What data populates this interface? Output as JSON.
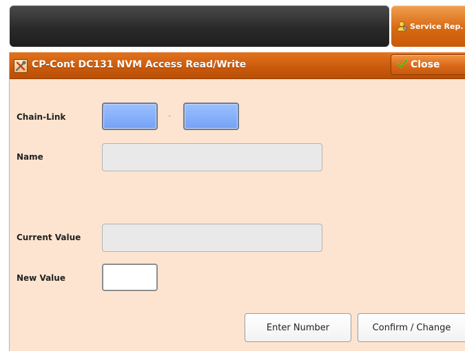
{
  "header": {
    "service_label": "Service Rep."
  },
  "dialog": {
    "title": "CP-Cont DC131 NVM Access Read/Write",
    "close_label": "Close"
  },
  "form": {
    "chain_link_label": "Chain-Link",
    "chain_link_separator": "-",
    "chain_value": "",
    "link_value": "",
    "name_label": "Name",
    "name_value": "",
    "current_value_label": "Current Value",
    "current_value": "",
    "new_value_label": "New Value",
    "new_value": ""
  },
  "buttons": {
    "enter_number": "Enter Number",
    "confirm_change": "Confirm / Change"
  },
  "colors": {
    "accent": "#d8661a",
    "window_bg": "#fce4d0",
    "chain_link_field": "#8cb4ff"
  }
}
